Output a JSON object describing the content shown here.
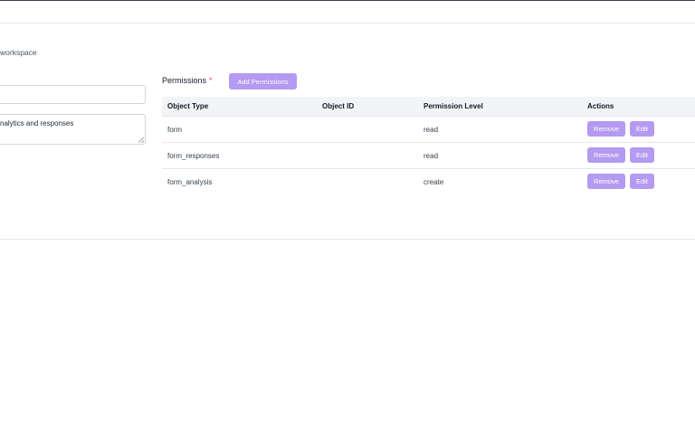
{
  "header": {},
  "form": {
    "workspace_text": "workspace",
    "name_value": "",
    "description_value": "nalytics and responses"
  },
  "permissions": {
    "label": "Permissions",
    "required_marker": "*",
    "add_button_label": "Add Permissions",
    "columns": [
      "Object Type",
      "Object ID",
      "Permission Level",
      "Actions"
    ],
    "rows": [
      {
        "object_type": "form",
        "object_id": "",
        "permission_level": "read",
        "remove_label": "Remove",
        "edit_label": "Edit"
      },
      {
        "object_type": "form_responses",
        "object_id": "",
        "permission_level": "read",
        "remove_label": "Remove",
        "edit_label": "Edit"
      },
      {
        "object_type": "form_analysis",
        "object_id": "",
        "permission_level": "create",
        "remove_label": "Remove",
        "edit_label": "Edit"
      }
    ]
  },
  "colors": {
    "accent": "#b49af0",
    "required": "#ef4444",
    "table_header_bg": "#f3f4f6"
  }
}
